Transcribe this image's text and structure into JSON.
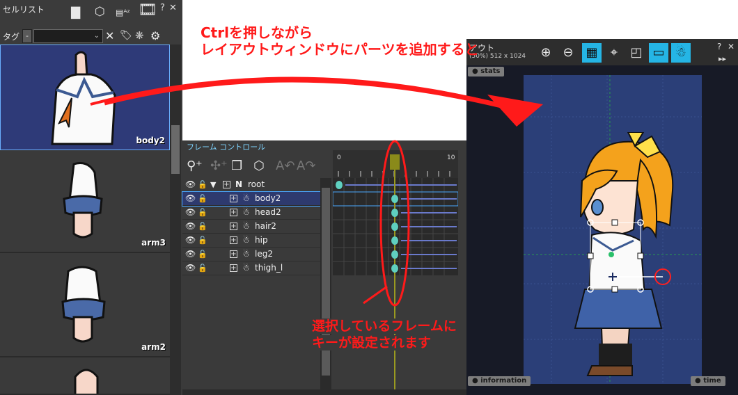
{
  "cell_panel": {
    "title": "セルリスト",
    "header_help": "?",
    "header_close": "✕",
    "tag_label": "タグ",
    "tag_value": "-",
    "cells": [
      {
        "label": "body2",
        "selected": true
      },
      {
        "label": "arm3",
        "selected": false
      },
      {
        "label": "arm2",
        "selected": false
      }
    ]
  },
  "frame_panel": {
    "title": "フレーム コントロール",
    "ruler": {
      "start": "0",
      "end": "10"
    },
    "layers": [
      {
        "name": "root",
        "tag": "N",
        "selected": false
      },
      {
        "name": "body2",
        "selected": true
      },
      {
        "name": "head2",
        "selected": false
      },
      {
        "name": "hair2",
        "selected": false
      },
      {
        "name": "hip",
        "selected": false
      },
      {
        "name": "leg2",
        "selected": false
      },
      {
        "name": "thigh_l",
        "selected": false
      }
    ]
  },
  "layout_panel": {
    "title": "アウト",
    "subtitle": "(50%) 512 x 1024",
    "header_help": "?",
    "header_close": "✕",
    "stats_label": "stats",
    "information_label": "information",
    "time_label": "time"
  },
  "annotations": {
    "top_line1": "Ctrlを押しながら",
    "top_line2": "レイアウトウィンドウにパーツを追加すると",
    "bottom_line1": "選択しているフレームに",
    "bottom_line2": "キーが設定されます"
  },
  "colors": {
    "annotation": "#ff1a1a",
    "selection": "#4aa8ff",
    "active_tool": "#25b5e5",
    "keyframe": "#5fd0c0"
  }
}
